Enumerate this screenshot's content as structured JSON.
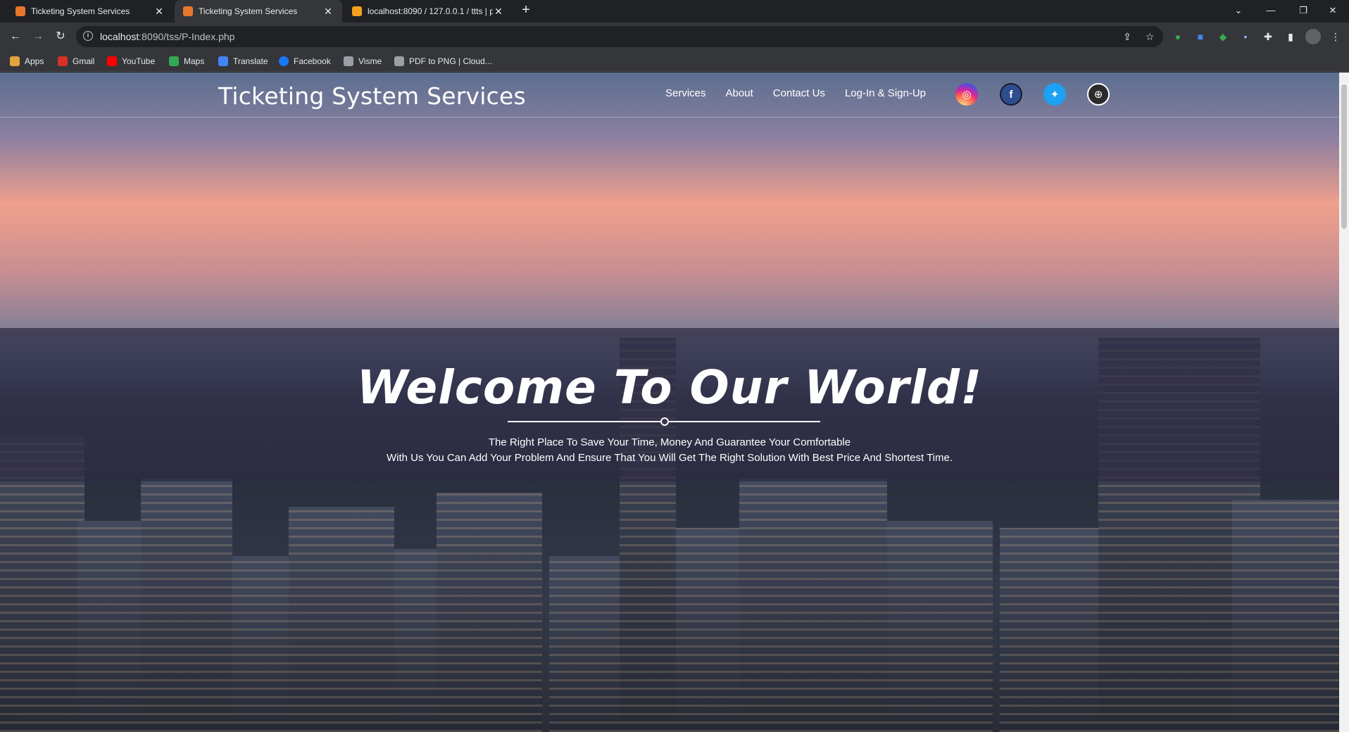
{
  "browser": {
    "tabs": [
      {
        "title": "Ticketing System Services",
        "active": false
      },
      {
        "title": "Ticketing System Services",
        "active": true
      },
      {
        "title": "localhost:8090 / 127.0.0.1 / ttts | p",
        "active": false
      }
    ],
    "url_host": "localhost",
    "url_path": ":8090/tss/P-Index.php",
    "bookmarks": [
      {
        "label": "Apps",
        "color": "#e5a33c"
      },
      {
        "label": "Gmail",
        "color": "#d93025"
      },
      {
        "label": "YouTube",
        "color": "#ff0000"
      },
      {
        "label": "Maps",
        "color": "#34a853"
      },
      {
        "label": "Translate",
        "color": "#4285f4"
      },
      {
        "label": "Facebook",
        "color": "#1877f2"
      },
      {
        "label": "Visme",
        "color": "#9aa0a6"
      },
      {
        "label": "PDF to PNG | Cloud...",
        "color": "#9aa0a6"
      }
    ]
  },
  "site": {
    "title": "Ticketing System Services",
    "nav": [
      "Services",
      "About",
      "Contact Us",
      "Log-In & Sign-Up"
    ],
    "social": [
      {
        "name": "instagram",
        "color": "#c13584"
      },
      {
        "name": "facebook",
        "color": "#1877f2"
      },
      {
        "name": "twitter",
        "color": "#1da1f2"
      },
      {
        "name": "website",
        "color": "#2b2b2b"
      }
    ]
  },
  "hero": {
    "title": "Welcome To Our World!",
    "line1": "The Right Place To Save Your Time, Money And Guarantee Your Comfortable",
    "line2": "With Us You Can Add Your Problem And Ensure That You Will Get The Right Solution With Best Price And Shortest Time."
  }
}
